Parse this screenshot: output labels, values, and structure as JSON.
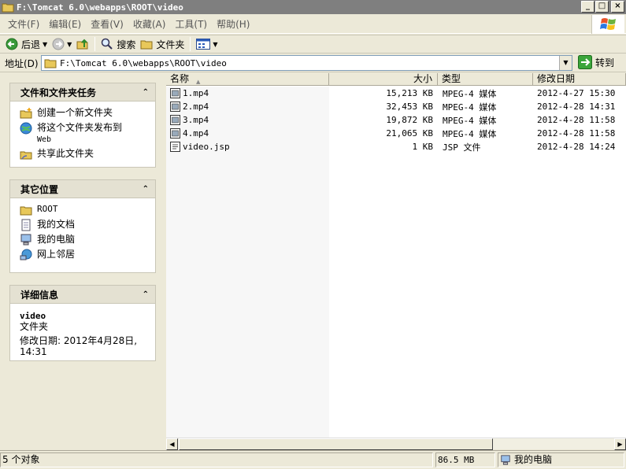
{
  "window": {
    "title": "F:\\Tomcat 6.0\\webapps\\ROOT\\video",
    "min_label": "_",
    "max_label": "□",
    "close_label": "×"
  },
  "menu": [
    "文件(F)",
    "编辑(E)",
    "查看(V)",
    "收藏(A)",
    "工具(T)",
    "帮助(H)"
  ],
  "toolbar": {
    "back_label": "后退",
    "search_label": "搜索",
    "folders_label": "文件夹"
  },
  "address": {
    "label": "地址(D)",
    "value": "F:\\Tomcat 6.0\\webapps\\ROOT\\video",
    "go_label": "转到"
  },
  "tasks_panel": {
    "title": "文件和文件夹任务",
    "items": [
      {
        "label": "创建一个新文件夹",
        "icon": "new-folder-icon"
      },
      {
        "label": "将这个文件夹发布到",
        "sub": "Web",
        "icon": "publish-web-icon"
      },
      {
        "label": "共享此文件夹",
        "icon": "share-folder-icon"
      }
    ]
  },
  "places_panel": {
    "title": "其它位置",
    "items": [
      {
        "label": "ROOT",
        "icon": "folder-icon"
      },
      {
        "label": "我的文档",
        "icon": "my-documents-icon"
      },
      {
        "label": "我的电脑",
        "icon": "my-computer-icon"
      },
      {
        "label": "网上邻居",
        "icon": "network-icon"
      }
    ]
  },
  "details_panel": {
    "title": "详细信息",
    "name": "video",
    "type": "文件夹",
    "modified_line1": "修改日期: 2012年4月28日,",
    "modified_line2": "14:31"
  },
  "columns": {
    "name": "名称",
    "size": "大小",
    "type": "类型",
    "date": "修改日期"
  },
  "files": [
    {
      "name": "1.mp4",
      "size": "15,213 KB",
      "type": "MPEG-4 媒体",
      "date": "2012-4-27 15:30"
    },
    {
      "name": "2.mp4",
      "size": "32,453 KB",
      "type": "MPEG-4 媒体",
      "date": "2012-4-28 14:31"
    },
    {
      "name": "3.mp4",
      "size": "19,872 KB",
      "type": "MPEG-4 媒体",
      "date": "2012-4-28 11:58"
    },
    {
      "name": "4.mp4",
      "size": "21,065 KB",
      "type": "MPEG-4 媒体",
      "date": "2012-4-28 11:58"
    },
    {
      "name": "video.jsp",
      "size": "1 KB",
      "type": "JSP 文件",
      "date": "2012-4-28 14:24"
    }
  ],
  "status": {
    "count": "5 个对象",
    "size": "86.5 MB",
    "location": "我的电脑"
  }
}
